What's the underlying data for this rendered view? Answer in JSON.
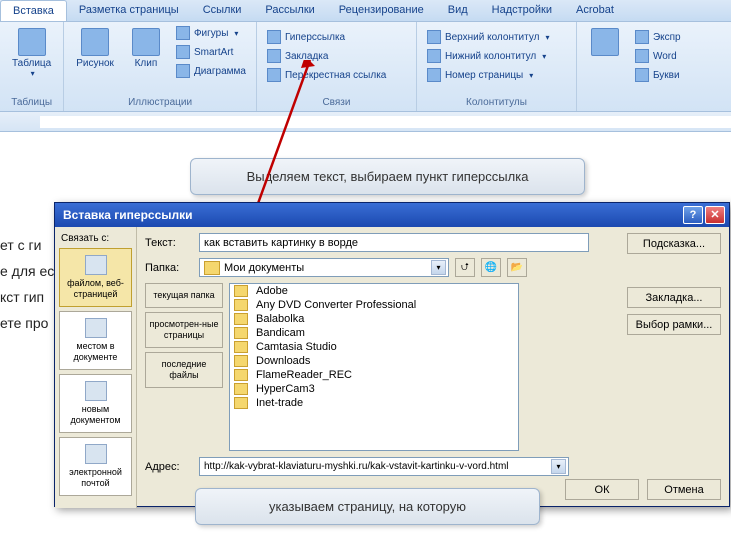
{
  "ribbon_tabs": [
    "Вставка",
    "Разметка страницы",
    "Ссылки",
    "Рассылки",
    "Рецензирование",
    "Вид",
    "Надстройки",
    "Acrobat"
  ],
  "active_tab": 0,
  "groups": {
    "tables": {
      "label": "Таблицы",
      "btn": "Таблица"
    },
    "illustrations": {
      "label": "Иллюстрации",
      "big": [
        "Рисунок",
        "Клип"
      ],
      "small": [
        "Фигуры",
        "SmartArt",
        "Диаграмма"
      ]
    },
    "links": {
      "label": "Связи",
      "small": [
        "Гиперссылка",
        "Закладка",
        "Перекрестная ссылка"
      ]
    },
    "headers": {
      "label": "Колонтитулы",
      "small": [
        "Верхний колонтитул",
        "Нижний колонтитул",
        "Номер страницы"
      ]
    },
    "text": {
      "small": [
        "Экспр",
        "Word",
        "Букви"
      ]
    }
  },
  "callout1": "Выделяем текст, выбираем пункт гиперссылка",
  "callout2": "указываем страницу, на которую",
  "doc_lines": [
    "ет с ги",
    "е для ес",
    "кст гип",
    "ете про"
  ],
  "dialog": {
    "title": "Вставка гиперссылки",
    "link_label": "Связать с:",
    "sidebar": [
      "файлом, веб-страницей",
      "местом в документе",
      "новым документом",
      "электронной почтой"
    ],
    "text_label": "Текст:",
    "text_value": "как вставить картинку в ворде",
    "folder_label": "Папка:",
    "folder_value": "Мои документы",
    "browse_tabs": [
      "текущая папка",
      "просмотрен-ные страницы",
      "последние файлы"
    ],
    "files": [
      "Adobe",
      "Any DVD Converter Professional",
      "Balabolka",
      "Bandicam",
      "Camtasia Studio",
      "Downloads",
      "FlameReader_REC",
      "HyperCam3",
      "Inet-trade"
    ],
    "addr_label": "Адрес:",
    "addr_value": "http://kak-vybrat-klaviaturu-myshki.ru/kak-vstavit-kartinku-v-vord.html",
    "btn_hint": "Подсказка...",
    "btn_bookmark": "Закладка...",
    "btn_frame": "Выбор рамки...",
    "btn_ok": "ОК",
    "btn_cancel": "Отмена"
  }
}
